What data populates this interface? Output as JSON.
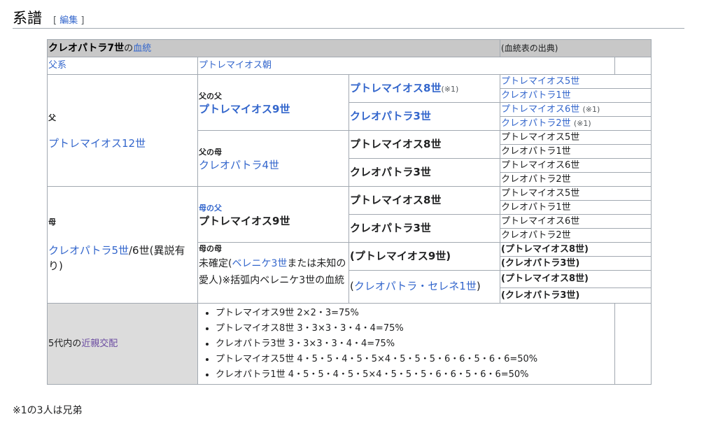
{
  "heading": {
    "title": "系譜",
    "bracket_open": "[",
    "edit": "編集",
    "bracket_close": "]"
  },
  "table": {
    "title_main": "クレオパトラ7世",
    "title_of": "の",
    "title_link": "血統",
    "source": "(血統表の出典)",
    "paternal_label": "父系",
    "paternal_value": "プトレマイオス朝",
    "father_label": "父",
    "father": "プトレマイオス12世",
    "ff_label": "父の父",
    "ff": "プトレマイオス9世",
    "fff": "プトレマイオス8世",
    "fff_note": "(※1)",
    "ffm": "クレオパトラ3世",
    "ffff": "プトレマイオス5世",
    "fffm": "クレオパトラ1世",
    "ffmf": "プトレマイオス6世",
    "ffmf_note": "(※1)",
    "ffmm": "クレオパトラ2世",
    "ffmm_note": "(※1)",
    "fm_label": "父の母",
    "fm": "クレオパトラ4世",
    "fmf": "プトレマイオス8世",
    "fmm": "クレオパトラ3世",
    "fmff": "プトレマイオス5世",
    "fmfm": "クレオパトラ1世",
    "fmmf": "プトレマイオス6世",
    "fmmm": "クレオパトラ2世",
    "mother_label": "母",
    "mother_link": "クレオパトラ5世",
    "mother_rest": "/6世(異説有り)",
    "mf_label": "母の父",
    "mf": "プトレマイオス9世",
    "mff": "プトレマイオス8世",
    "mfm": "クレオパトラ3世",
    "mfff": "プトレマイオス5世",
    "mffm": "クレオパトラ1世",
    "mfmf": "プトレマイオス6世",
    "mfmm": "クレオパトラ2世",
    "mm_label": "母の母",
    "mm_pre": "未確定(",
    "mm_link": "ベレニケ3世",
    "mm_post": "または未知の愛人)※括弧内ベレニケ3世の血統",
    "mmf": "(プトレマイオス9世)",
    "mmm_open": "(",
    "mmm_link": "クレオパトラ・セレネ1世",
    "mmm_close": ")",
    "mmff": "(プトレマイオス8世)",
    "mmfm": "(クレオパトラ3世)",
    "mmmf": "(プトレマイオス8世)",
    "mmmm": "(クレオパトラ3世)",
    "inbreeding_label_pre": "5代内の",
    "inbreeding_label_link": "近親交配",
    "inbreeding": [
      "プトレマイオス9世 2×2・3=75%",
      "プトレマイオス8世 3・3×3・3・4・4=75%",
      "クレオパトラ3世 3・3×3・3・4・4=75%",
      "プトレマイオス5世 4・5・5・4・5・5×4・5・5・5・6・6・5・6・6=50%",
      "クレオパトラ1世 4・5・5・4・5・5×4・5・5・5・6・6・5・6・6=50%"
    ]
  },
  "footnote": "※1の3人は兄弟"
}
